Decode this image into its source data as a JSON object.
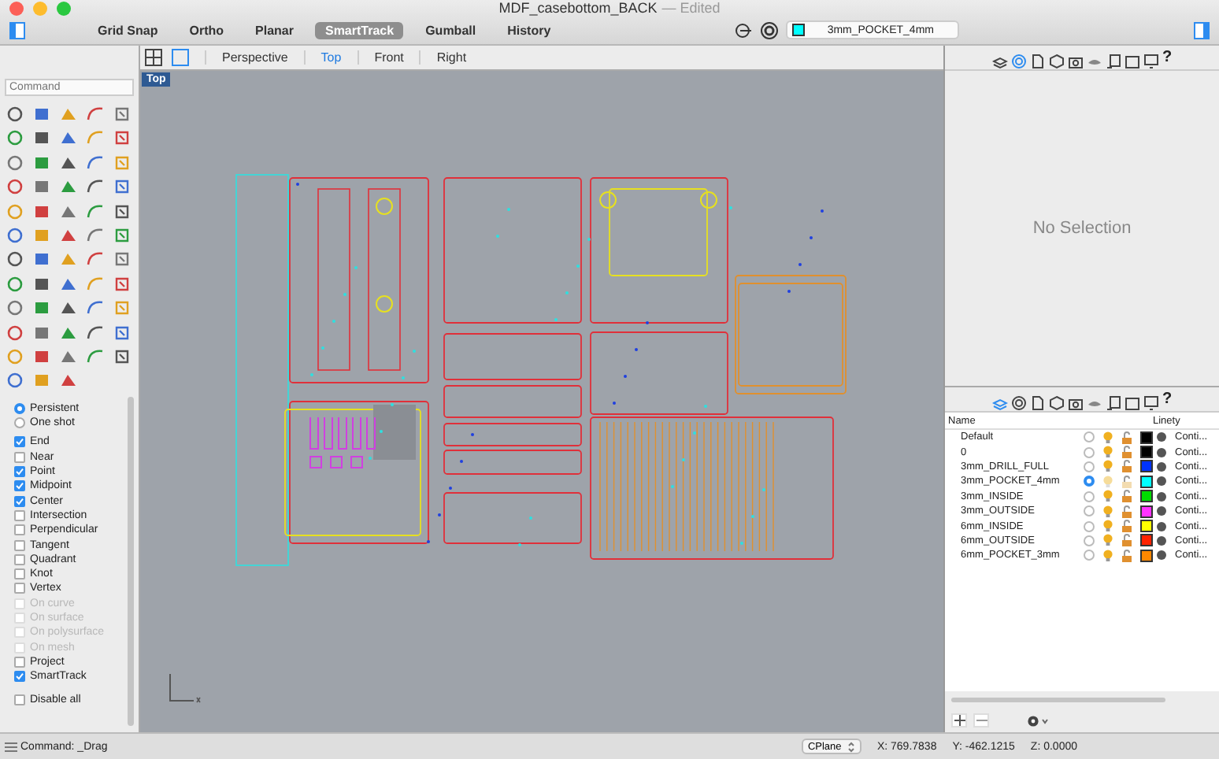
{
  "window": {
    "title": "MDF_casebottom_BACK",
    "status": "— Edited"
  },
  "toolbar": {
    "modes": [
      {
        "label": "Grid Snap",
        "selected": false
      },
      {
        "label": "Ortho",
        "selected": false
      },
      {
        "label": "Planar",
        "selected": false
      },
      {
        "label": "SmartTrack",
        "selected": true
      },
      {
        "label": "Gumball",
        "selected": false
      },
      {
        "label": "History",
        "selected": false
      }
    ],
    "current_layer": {
      "name": "3mm_POCKET_4mm",
      "color": "#00ffff"
    }
  },
  "viewport_tabs": [
    {
      "label": "Perspective",
      "selected": false
    },
    {
      "label": "Top",
      "selected": true
    },
    {
      "label": "Front",
      "selected": false
    },
    {
      "label": "Right",
      "selected": false
    }
  ],
  "viewport": {
    "label": "Top"
  },
  "command": {
    "placeholder": "Command"
  },
  "osnap": {
    "modes": [
      {
        "label": "Persistent",
        "selected": true
      },
      {
        "label": "One shot",
        "selected": false
      }
    ],
    "snaps": [
      {
        "label": "End",
        "checked": true,
        "disabled": false
      },
      {
        "label": "Near",
        "checked": false,
        "disabled": false
      },
      {
        "label": "Point",
        "checked": true,
        "disabled": false
      },
      {
        "label": "Midpoint",
        "checked": true,
        "disabled": false
      },
      {
        "label": "Center",
        "checked": true,
        "disabled": false
      },
      {
        "label": "Intersection",
        "checked": false,
        "disabled": false
      },
      {
        "label": "Perpendicular",
        "checked": false,
        "disabled": false
      },
      {
        "label": "Tangent",
        "checked": false,
        "disabled": false
      },
      {
        "label": "Quadrant",
        "checked": false,
        "disabled": false
      },
      {
        "label": "Knot",
        "checked": false,
        "disabled": false
      },
      {
        "label": "Vertex",
        "checked": false,
        "disabled": false
      },
      {
        "label": "On curve",
        "checked": false,
        "disabled": true
      },
      {
        "label": "On surface",
        "checked": false,
        "disabled": true
      },
      {
        "label": "On polysurface",
        "checked": false,
        "disabled": true
      },
      {
        "label": "On mesh",
        "checked": false,
        "disabled": true
      },
      {
        "label": "Project",
        "checked": false,
        "disabled": false
      },
      {
        "label": "SmartTrack",
        "checked": true,
        "disabled": false
      }
    ],
    "disable_all": {
      "label": "Disable all",
      "checked": false
    }
  },
  "properties_panel": {
    "tabs": [
      {
        "kind": "layers",
        "selected": false
      },
      {
        "kind": "properties",
        "selected": true
      },
      {
        "kind": "document",
        "selected": false
      },
      {
        "kind": "cube",
        "selected": false
      },
      {
        "kind": "camera",
        "selected": false
      },
      {
        "kind": "render",
        "selected": false
      },
      {
        "kind": "page",
        "selected": false
      },
      {
        "kind": "frame",
        "selected": false
      },
      {
        "kind": "display",
        "selected": false
      }
    ],
    "help": "?",
    "message": "No Selection"
  },
  "layers_panel": {
    "tabs": [
      {
        "kind": "layers",
        "selected": true
      },
      {
        "kind": "properties",
        "selected": false
      },
      {
        "kind": "document",
        "selected": false
      },
      {
        "kind": "cube",
        "selected": false
      },
      {
        "kind": "camera",
        "selected": false
      },
      {
        "kind": "render",
        "selected": false
      },
      {
        "kind": "page",
        "selected": false
      },
      {
        "kind": "frame",
        "selected": false
      },
      {
        "kind": "display",
        "selected": false
      }
    ],
    "help": "?",
    "columns": [
      "Name",
      "Linety"
    ],
    "rows": [
      {
        "name": "Default",
        "current": false,
        "color": "#000000",
        "linetype": "Conti..."
      },
      {
        "name": "0",
        "current": false,
        "color": "#000000",
        "linetype": "Conti..."
      },
      {
        "name": "3mm_DRILL_FULL",
        "current": false,
        "color": "#0033ff",
        "linetype": "Conti..."
      },
      {
        "name": "3mm_POCKET_4mm",
        "current": true,
        "color": "#00ffff",
        "linetype": "Conti..."
      },
      {
        "name": "3mm_INSIDE",
        "current": false,
        "color": "#00dd00",
        "linetype": "Conti..."
      },
      {
        "name": "3mm_OUTSIDE",
        "current": false,
        "color": "#ff33ff",
        "linetype": "Conti..."
      },
      {
        "name": "6mm_INSIDE",
        "current": false,
        "color": "#ffff00",
        "linetype": "Conti..."
      },
      {
        "name": "6mm_OUTSIDE",
        "current": false,
        "color": "#ff2200",
        "linetype": "Conti..."
      },
      {
        "name": "6mm_POCKET_3mm",
        "current": false,
        "color": "#ff8800",
        "linetype": "Conti..."
      }
    ]
  },
  "status_bar": {
    "command": "Command: _Drag",
    "cplane": "CPlane",
    "x": "X: 769.7838",
    "y": "Y: -462.1215",
    "z": "Z: 0.0000"
  }
}
